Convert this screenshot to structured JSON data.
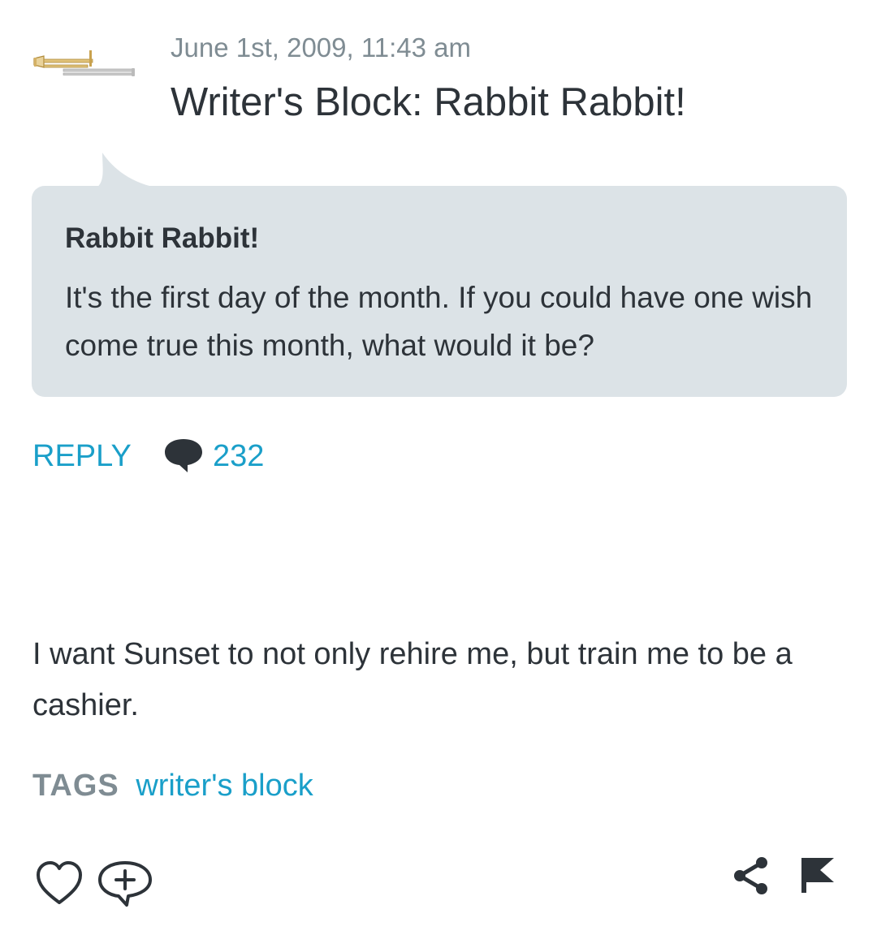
{
  "post": {
    "date": "June 1st, 2009, 11:43 am",
    "title": "Writer's Block: Rabbit Rabbit!"
  },
  "prompt": {
    "heading": "Rabbit Rabbit!",
    "text": "It's the first day of the month. If you could have one wish come true this month, what would it be?"
  },
  "actions": {
    "reply_label": "REPLY",
    "comment_count": "232"
  },
  "body": {
    "text": "I want Sunset to not only rehire me, but train me to be a cashier."
  },
  "tags": {
    "label": "TAGS",
    "items": [
      "writer's block"
    ]
  },
  "icons": {
    "avatar": "trombone-avatar-icon",
    "comment": "speech-bubble-icon",
    "like": "heart-icon",
    "reblog": "add-comment-icon",
    "share": "share-icon",
    "flag": "flag-icon"
  },
  "colors": {
    "accent": "#1a9fc9",
    "text": "#2d3339",
    "muted": "#7f8c93",
    "prompt_bg": "#dce3e7"
  }
}
